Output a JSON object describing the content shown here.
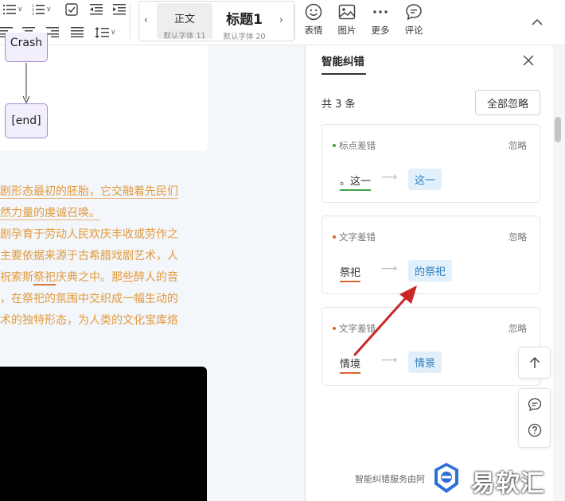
{
  "toolbar": {
    "style_normal": "正文",
    "style_normal_sub": "默认字体 11",
    "style_h1": "标题1",
    "style_h1_sub": "默认字体 20",
    "emoji_label": "表情",
    "image_label": "图片",
    "more_label": "更多",
    "comment_label": "评论"
  },
  "document": {
    "flow_nodes": [
      "Crash",
      "[end]"
    ],
    "lines": [
      "剧形态最初的胚胎，它交融着先民们",
      "然力量的虔诚召唤。",
      "剧孕育于劳动人民欢庆丰收或劳作之",
      "主要依据来源于古希腊戏剧艺术，人",
      "祝索斯",
      "祭祀",
      "庆典之中。那些醉人的音",
      "，在祭祀的氛围中交织成一幅生动的",
      "术的独特形态，为人类的文化宝库烙"
    ]
  },
  "panel": {
    "tab_label": "智能纠错",
    "count_text": "共 3 条",
    "ignore_all_label": "全部忽略",
    "cards": [
      {
        "type": "标点差错",
        "ignore": "忽略",
        "original": "。这一",
        "arrow": "⟶",
        "suggestion": "这一",
        "dot_color": "#3aa34a"
      },
      {
        "type": "文字差错",
        "ignore": "忽略",
        "original": "祭祀",
        "arrow": "⟶",
        "suggestion": "的祭祀",
        "dot_color": "#d9652e"
      },
      {
        "type": "文字差错",
        "ignore": "忽略",
        "original": "情境",
        "arrow": "⟶",
        "suggestion": "情景",
        "dot_color": "#d9652e"
      }
    ],
    "footer": "智能纠错服务由阿"
  },
  "watermark": {
    "text": "易软汇"
  },
  "icons": {
    "list": "list-icon",
    "numbered_list": "numbered-list-icon",
    "checkbox": "checkbox-icon",
    "outdent": "outdent-icon",
    "indent": "indent-icon",
    "align_left": "align-left-icon",
    "align_center": "align-center-icon",
    "align_right": "align-right-icon",
    "justify": "justify-icon",
    "line_spacing": "line-spacing-icon",
    "emoji": "emoji-icon",
    "image": "image-icon",
    "more": "more-icon",
    "comment": "comment-icon",
    "chevron_up": "chevron-up-icon",
    "close": "close-icon",
    "arrow_up": "arrow-up-icon",
    "help": "help-icon"
  }
}
